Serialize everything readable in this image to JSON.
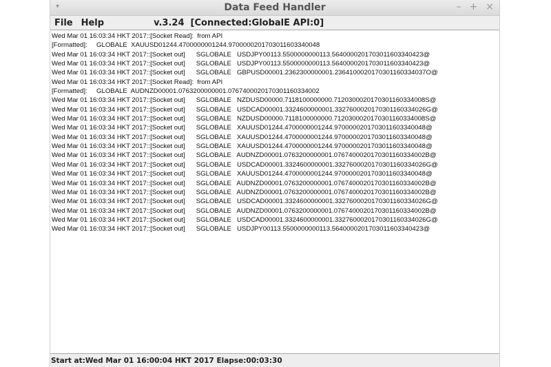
{
  "window": {
    "title": "Data Feed Handler",
    "menu_icon": "▾",
    "controls": {
      "minimize": "–",
      "maximize": "+",
      "close": "×"
    }
  },
  "menubar": {
    "file_label": "File",
    "help_label": "Help",
    "version_status": "v.3.24  [Connected:GlobalE API:0]"
  },
  "log": {
    "lines": [
      "Wed Mar 01 16:03:34 HKT 2017::[Socket Read]:  from API",
      "[Formatted]:     GLOBALE  XAUUSD01244.4700000001244.9700000201703011603340048",
      "Wed Mar 01 16:03:34 HKT 2017::[Socket out]      SGLOBALE   USDJPY00113.5500000000113.5640000201703011603340423@",
      "Wed Mar 01 16:03:34 HKT 2017::[Socket out]      SGLOBALE   USDJPY00113.5500000000113.5640000201703011603340423@",
      "Wed Mar 01 16:03:34 HKT 2017::[Socket out]      SGLOBALE   GBPUSD00001.2362300000001.2364100020170301160334037O@",
      "Wed Mar 01 16:03:34 HKT 2017::[Socket Read]:  from API",
      "[Formatted]:     GLOBALE  AUDNZD00001.0763200000001.0767400020170301160334002",
      "Wed Mar 01 16:03:34 HKT 2017::[Socket out]      SGLOBALE   NZDUSD00000.7118100000000.7120300020170301160334008S@",
      "Wed Mar 01 16:03:34 HKT 2017::[Socket out]      SGLOBALE   USDCAD00001.3324600000001.3327600020170301160334026G@",
      "Wed Mar 01 16:03:34 HKT 2017::[Socket out]      SGLOBALE   NZDUSD00000.7118100000000.7120300020170301160334008S@",
      "Wed Mar 01 16:03:34 HKT 2017::[Socket out]      SGLOBALE   XAUUSD01244.4700000001244.9700000201703011603340048@",
      "Wed Mar 01 16:03:34 HKT 2017::[Socket out]      SGLOBALE   XAUUSD01244.4700000001244.9700000201703011603340048@",
      "Wed Mar 01 16:03:34 HKT 2017::[Socket out]      SGLOBALE   XAUUSD01244.4700000001244.9700000201703011603340048@",
      "Wed Mar 01 16:03:34 HKT 2017::[Socket out]      SGLOBALE   AUDNZD00001.0763200000001.0767400020170301160334002B@",
      "Wed Mar 01 16:03:34 HKT 2017::[Socket out]      SGLOBALE   USDCAD00001.3324600000001.3327600020170301160334026G@",
      "Wed Mar 01 16:03:34 HKT 2017::[Socket out]      SGLOBALE   XAUUSD01244.4700000001244.9700000201703011603340048@",
      "Wed Mar 01 16:03:34 HKT 2017::[Socket out]      SGLOBALE   AUDNZD00001.0763200000001.0767400020170301160334002B@",
      "Wed Mar 01 16:03:34 HKT 2017::[Socket out]      SGLOBALE   AUDNZD00001.0763200000001.0767400020170301160334002B@",
      "Wed Mar 01 16:03:34 HKT 2017::[Socket out]      SGLOBALE   USDCAD00001.3324600000001.3327600020170301160334026G@",
      "Wed Mar 01 16:03:34 HKT 2017::[Socket out]      SGLOBALE   AUDNZD00001.0763200000001.0767400020170301160334002B@",
      "Wed Mar 01 16:03:34 HKT 2017::[Socket out]      SGLOBALE   USDCAD00001.3324600000001.3327600020170301160334026G@",
      "Wed Mar 01 16:03:34 HKT 2017::[Socket out]      SGLOBALE   USDJPY00113.5500000000113.5640000201703011603340423@"
    ]
  },
  "statusbar": {
    "text": "Start at:Wed Mar 01 16:00:04 HKT 2017 Elapse:00:03:30"
  }
}
